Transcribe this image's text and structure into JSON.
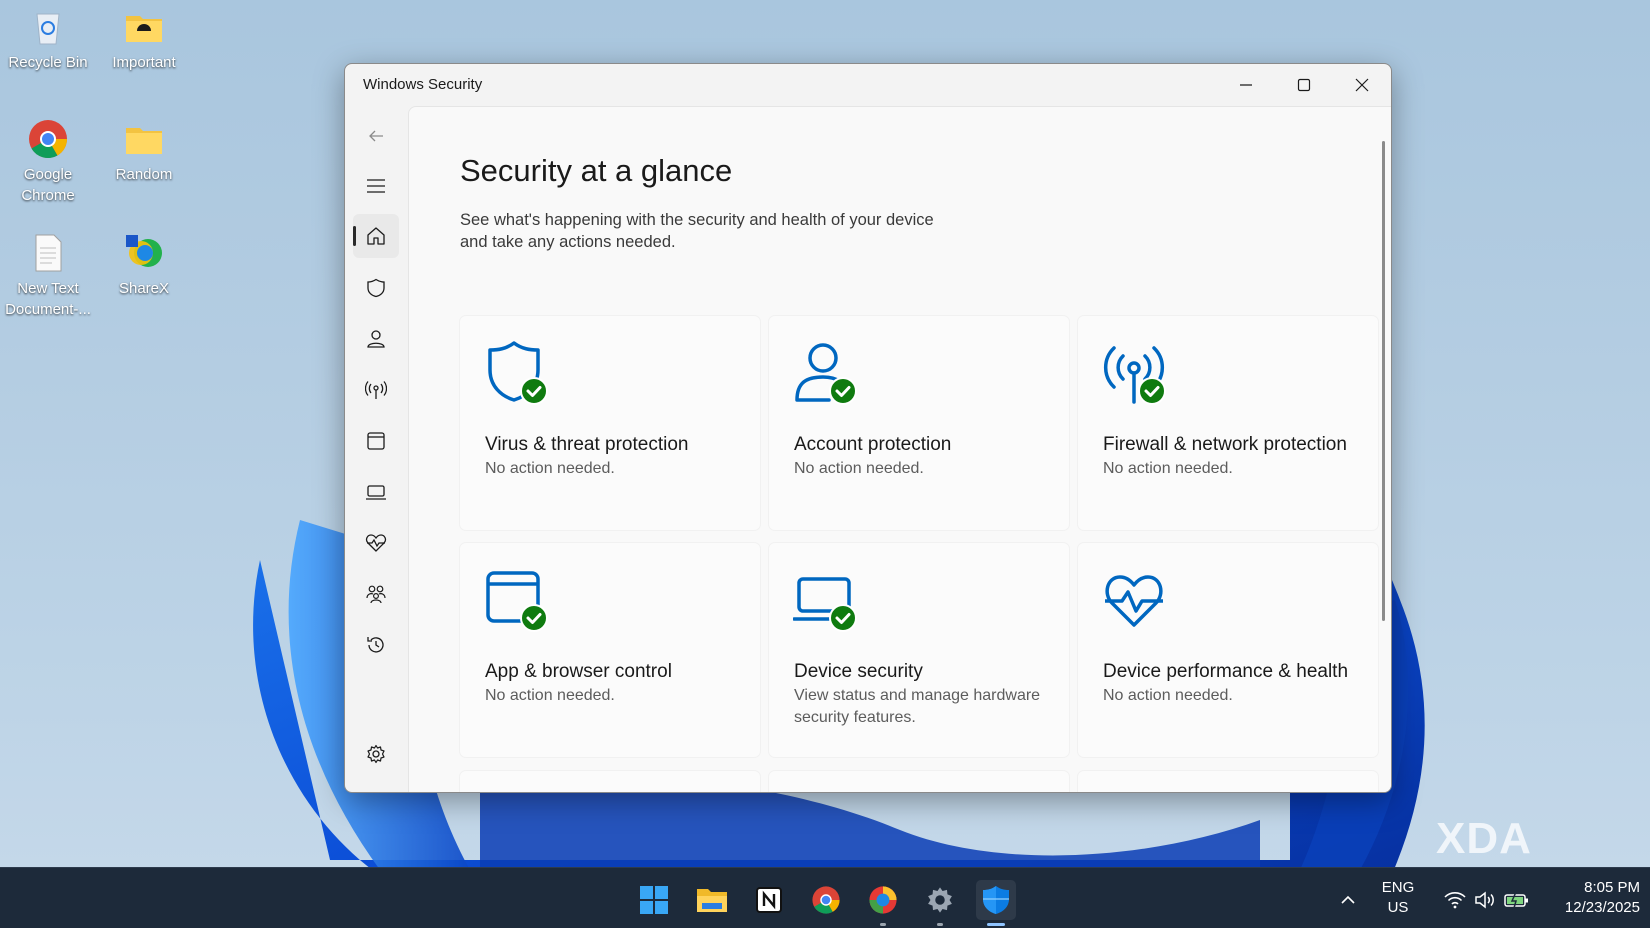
{
  "desktop": {
    "icons": [
      {
        "label": "Recycle Bin"
      },
      {
        "label": "Important"
      },
      {
        "label": "Google Chrome"
      },
      {
        "label": "Random"
      },
      {
        "label": "New Text Document-..."
      },
      {
        "label": "ShareX"
      }
    ]
  },
  "window": {
    "title": "Windows Security",
    "nav": [
      "back-icon",
      "menu-icon",
      "home-icon",
      "shield-icon",
      "person-icon",
      "broadcast-icon",
      "app-window-icon",
      "laptop-icon",
      "heart-pulse-icon",
      "family-icon",
      "history-icon",
      "settings-icon"
    ],
    "page": {
      "title": "Security at a glance",
      "subtitle": "See what's happening with the security and health of your device and take any actions needed."
    },
    "cards": [
      {
        "title": "Virus & threat protection",
        "status": "No action needed.",
        "icon": "shield-check-icon"
      },
      {
        "title": "Account protection",
        "status": "No action needed.",
        "icon": "account-check-icon"
      },
      {
        "title": "Firewall & network protection",
        "status": "No action needed.",
        "icon": "firewall-check-icon"
      },
      {
        "title": "App & browser control",
        "status": "No action needed.",
        "icon": "browser-check-icon"
      },
      {
        "title": "Device security",
        "status": "View status and manage hardware security features.",
        "icon": "device-check-icon"
      },
      {
        "title": "Device performance & health",
        "status": "No action needed.",
        "icon": "heart-pulse-icon"
      }
    ]
  },
  "taskbar": {
    "apps": [
      "start-icon",
      "file-explorer-icon",
      "notion-icon",
      "chrome-icon",
      "edge-icon",
      "settings-icon",
      "windows-security-icon"
    ],
    "lang_top": "ENG",
    "lang_bottom": "US",
    "time": "8:05 PM",
    "date": "12/23/2025"
  },
  "watermark": "XDA",
  "colors": {
    "accent": "#0067c0",
    "check": "#0f7b0f"
  }
}
